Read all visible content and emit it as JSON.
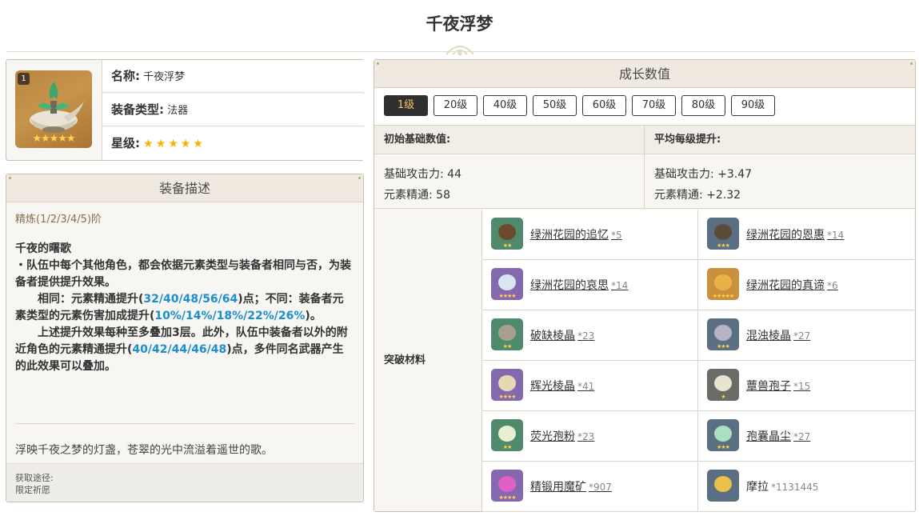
{
  "page_title": "千夜浮梦",
  "info": {
    "name_label": "名称:",
    "name_value": "千夜浮梦",
    "type_label": "装备类型:",
    "type_value": "法器",
    "rarity_label": "星级:",
    "rarity_stars": "★★★★★",
    "rarity_number": "1",
    "art_stars": "★★★★★"
  },
  "description": {
    "title": "装备描述",
    "refine": "精炼(1/2/3/4/5)阶",
    "skill_name": "千夜的曙歌",
    "line1": "・队伍中每个其他角色，都会依据元素类型与装备者相同与否，为装备者提供提升效果。",
    "line2_a": "相同：元素精通提升(",
    "line2_hl1": "32/40/48/56/64",
    "line2_b": ")点；不同：装备者元素类型的元素伤害加成提升(",
    "line2_hl2": "10%/14%/18%/22%/26%",
    "line2_c": ")。",
    "line3_a": "上述提升效果每种至多叠加3层。此外，队伍中装备者以外的附近角色的元素精通提升(",
    "line3_hl": "40/42/44/46/48",
    "line3_b": ")点，多件同名武器产生的此效果可以叠加。",
    "flavor": "浮映千夜之梦的灯盏，苍翠的光中流溢着遥世的歌。",
    "obtain_label": "获取途径:",
    "obtain_value": "限定祈愿"
  },
  "growth": {
    "title": "成长数值",
    "levels": [
      "1级",
      "20级",
      "40级",
      "50级",
      "60级",
      "70级",
      "80级",
      "90级"
    ],
    "active_level": "1级",
    "base_header": "初始基础数值:",
    "avg_header": "平均每级提升:",
    "base_stat1": "基础攻击力: 44",
    "base_stat2": "元素精通: 58",
    "avg_stat1": "基础攻击力: +3.47",
    "avg_stat2": "元素精通: +2.32",
    "materials_label": "突破材料",
    "materials": [
      {
        "name": "绿洲花园的追忆",
        "count": "*5",
        "color": "#6b4a2e",
        "bg": "#4e8a6b",
        "stars": "★★"
      },
      {
        "name": "绿洲花园的恩惠",
        "count": "*14",
        "color": "#5a4a3a",
        "bg": "#5b6f83",
        "stars": "★★★"
      },
      {
        "name": "绿洲花园的哀思",
        "count": "*14",
        "color": "#d9e6f2",
        "bg": "#8469b1",
        "stars": "★★★★"
      },
      {
        "name": "绿洲花园的真谛",
        "count": "*6",
        "color": "#e7b347",
        "bg": "#c9913c",
        "stars": "★★★★★"
      },
      {
        "name": "破缺棱晶",
        "count": "*23",
        "color": "#a7a08f",
        "bg": "#4e8a6b",
        "stars": "★★"
      },
      {
        "name": "混浊棱晶",
        "count": "*27",
        "color": "#b8b4c8",
        "bg": "#5b6f83",
        "stars": "★★★"
      },
      {
        "name": "辉光棱晶",
        "count": "*41",
        "color": "#e4d9b0",
        "bg": "#8469b1",
        "stars": "★★★★"
      },
      {
        "name": "蕈兽孢子",
        "count": "*15",
        "color": "#e8e2cf",
        "bg": "#6a6a66",
        "stars": "★"
      },
      {
        "name": "荧光孢粉",
        "count": "*23",
        "color": "#e9efd3",
        "bg": "#4e8a6b",
        "stars": "★★"
      },
      {
        "name": "孢囊晶尘",
        "count": "*27",
        "color": "#a8e0c0",
        "bg": "#5b6f83",
        "stars": "★★★"
      },
      {
        "name": "精锻用魔矿",
        "count": "*907",
        "color": "#e060c8",
        "bg": "#8469b1",
        "stars": "★★★★"
      },
      {
        "name": "摩拉",
        "count": "*1131445",
        "color": "#e8c04a",
        "bg": "#5b6f83",
        "stars": ""
      }
    ]
  }
}
